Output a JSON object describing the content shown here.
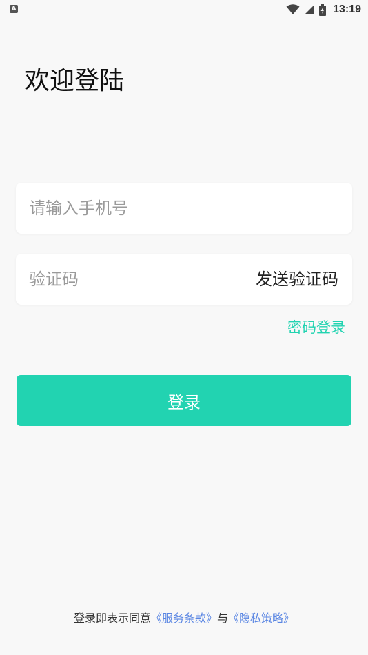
{
  "status_bar": {
    "notification_icon": "A",
    "time": "13:19",
    "icons": [
      "wifi-icon",
      "cell-signal-icon",
      "battery-icon"
    ]
  },
  "title": "欢迎登陆",
  "phone_input": {
    "value": "",
    "placeholder": "请输入手机号"
  },
  "code_input": {
    "value": "",
    "placeholder": "验证码"
  },
  "send_code_label": "发送验证码",
  "password_login_label": "密码登录",
  "login_button_label": "登录",
  "agreement": {
    "prefix": "登录即表示同意",
    "terms_link": "《服务条款》",
    "conjunction": "与",
    "privacy_link": "《隐私策略》"
  },
  "colors": {
    "accent": "#22d3b1",
    "link": "#5a86e3",
    "background": "#f8f8f8"
  }
}
